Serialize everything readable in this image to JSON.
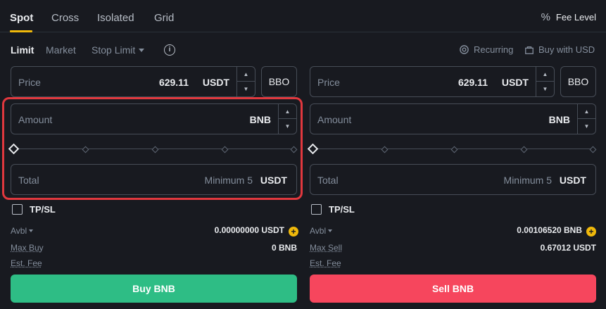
{
  "tabs": [
    "Spot",
    "Cross",
    "Isolated",
    "Grid"
  ],
  "fee_level": {
    "icon": "percent-icon",
    "label": "Fee Level"
  },
  "order_types": {
    "limit": "Limit",
    "market": "Market",
    "stop_limit": "Stop Limit"
  },
  "recurring": {
    "icon": "recurring-icon",
    "label": "Recurring"
  },
  "buy_with_usd": {
    "icon": "bag-icon",
    "label": "Buy with USD"
  },
  "buy": {
    "price_label": "Price",
    "price_value": "629.11",
    "price_unit": "USDT",
    "bbo": "BBO",
    "amount_label": "Amount",
    "amount_unit": "BNB",
    "total_label": "Total",
    "total_hint": "Minimum 5",
    "total_unit": "USDT",
    "tpsl": "TP/SL",
    "avbl_label": "Avbl",
    "avbl_value": "0.00000000 USDT",
    "max_label": "Max Buy",
    "max_value": "0 BNB",
    "fee_label": "Est. Fee",
    "button": "Buy BNB"
  },
  "sell": {
    "price_label": "Price",
    "price_value": "629.11",
    "price_unit": "USDT",
    "bbo": "BBO",
    "amount_label": "Amount",
    "amount_unit": "BNB",
    "total_label": "Total",
    "total_hint": "Minimum 5",
    "total_unit": "USDT",
    "tpsl": "TP/SL",
    "avbl_label": "Avbl",
    "avbl_value": "0.00106520 BNB",
    "max_label": "Max Sell",
    "max_value": "0.67012 USDT",
    "fee_label": "Est. Fee",
    "button": "Sell BNB"
  },
  "colors": {
    "buy": "#2ebd85",
    "sell": "#f6465d",
    "accent": "#f0b90b",
    "highlight": "#e0383e"
  }
}
